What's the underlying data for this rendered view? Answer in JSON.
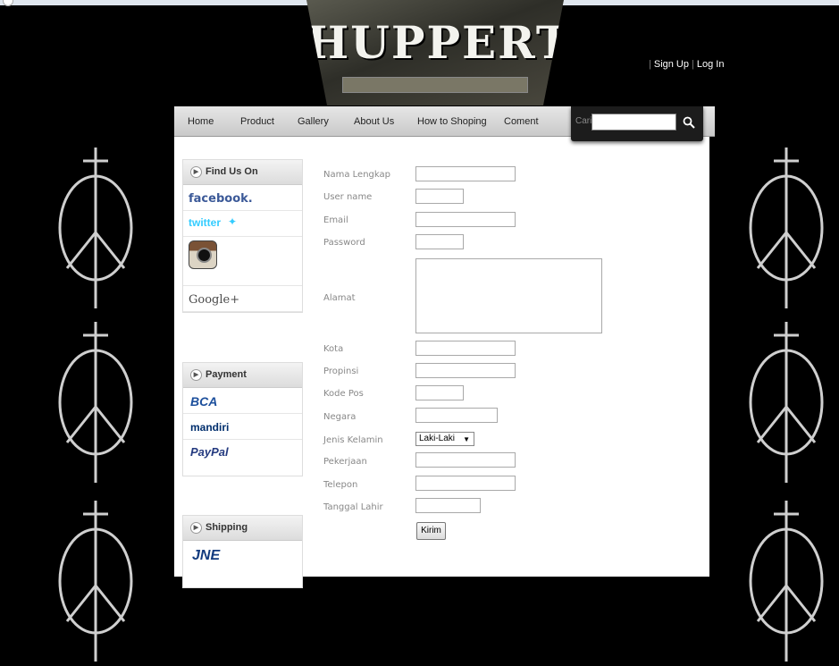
{
  "header": {
    "brand_title": "HUPPERTS",
    "links": [
      "Sign Up",
      "Log In"
    ]
  },
  "nav": {
    "items": [
      "Home",
      "Product",
      "Gallery",
      "About Us",
      "How to Shoping",
      "Coment"
    ]
  },
  "search": {
    "label": "Cari",
    "button_icon": "search-icon"
  },
  "sidebar": {
    "find_us": {
      "title": "Find Us On",
      "items": [
        "facebook.",
        "twitter",
        "instagram",
        "Google+"
      ]
    },
    "payment": {
      "title": "Payment",
      "items": [
        "BCA",
        "mandiri",
        "PayPal"
      ]
    },
    "shipping": {
      "title": "Shipping",
      "items": [
        "JNE"
      ]
    }
  },
  "form": {
    "labels": {
      "nama": "Nama Lengkap",
      "username": "User name",
      "email": "Email",
      "password": "Password",
      "alamat": "Alamat",
      "kota": "Kota",
      "propinsi": "Propinsi",
      "kodepos": "Kode Pos",
      "negara": "Negara",
      "jk": "Jenis Kelamin",
      "pekerjaan": "Pekerjaan",
      "telepon": "Telepon",
      "tgl": "Tanggal Lahir"
    },
    "gender_selected": "Laki-Laki",
    "submit_label": "Kirim"
  },
  "colors": {
    "background": "#000000",
    "nav_gradient_top": "#e6e6e6",
    "search_bg": "#1c1c1c"
  }
}
